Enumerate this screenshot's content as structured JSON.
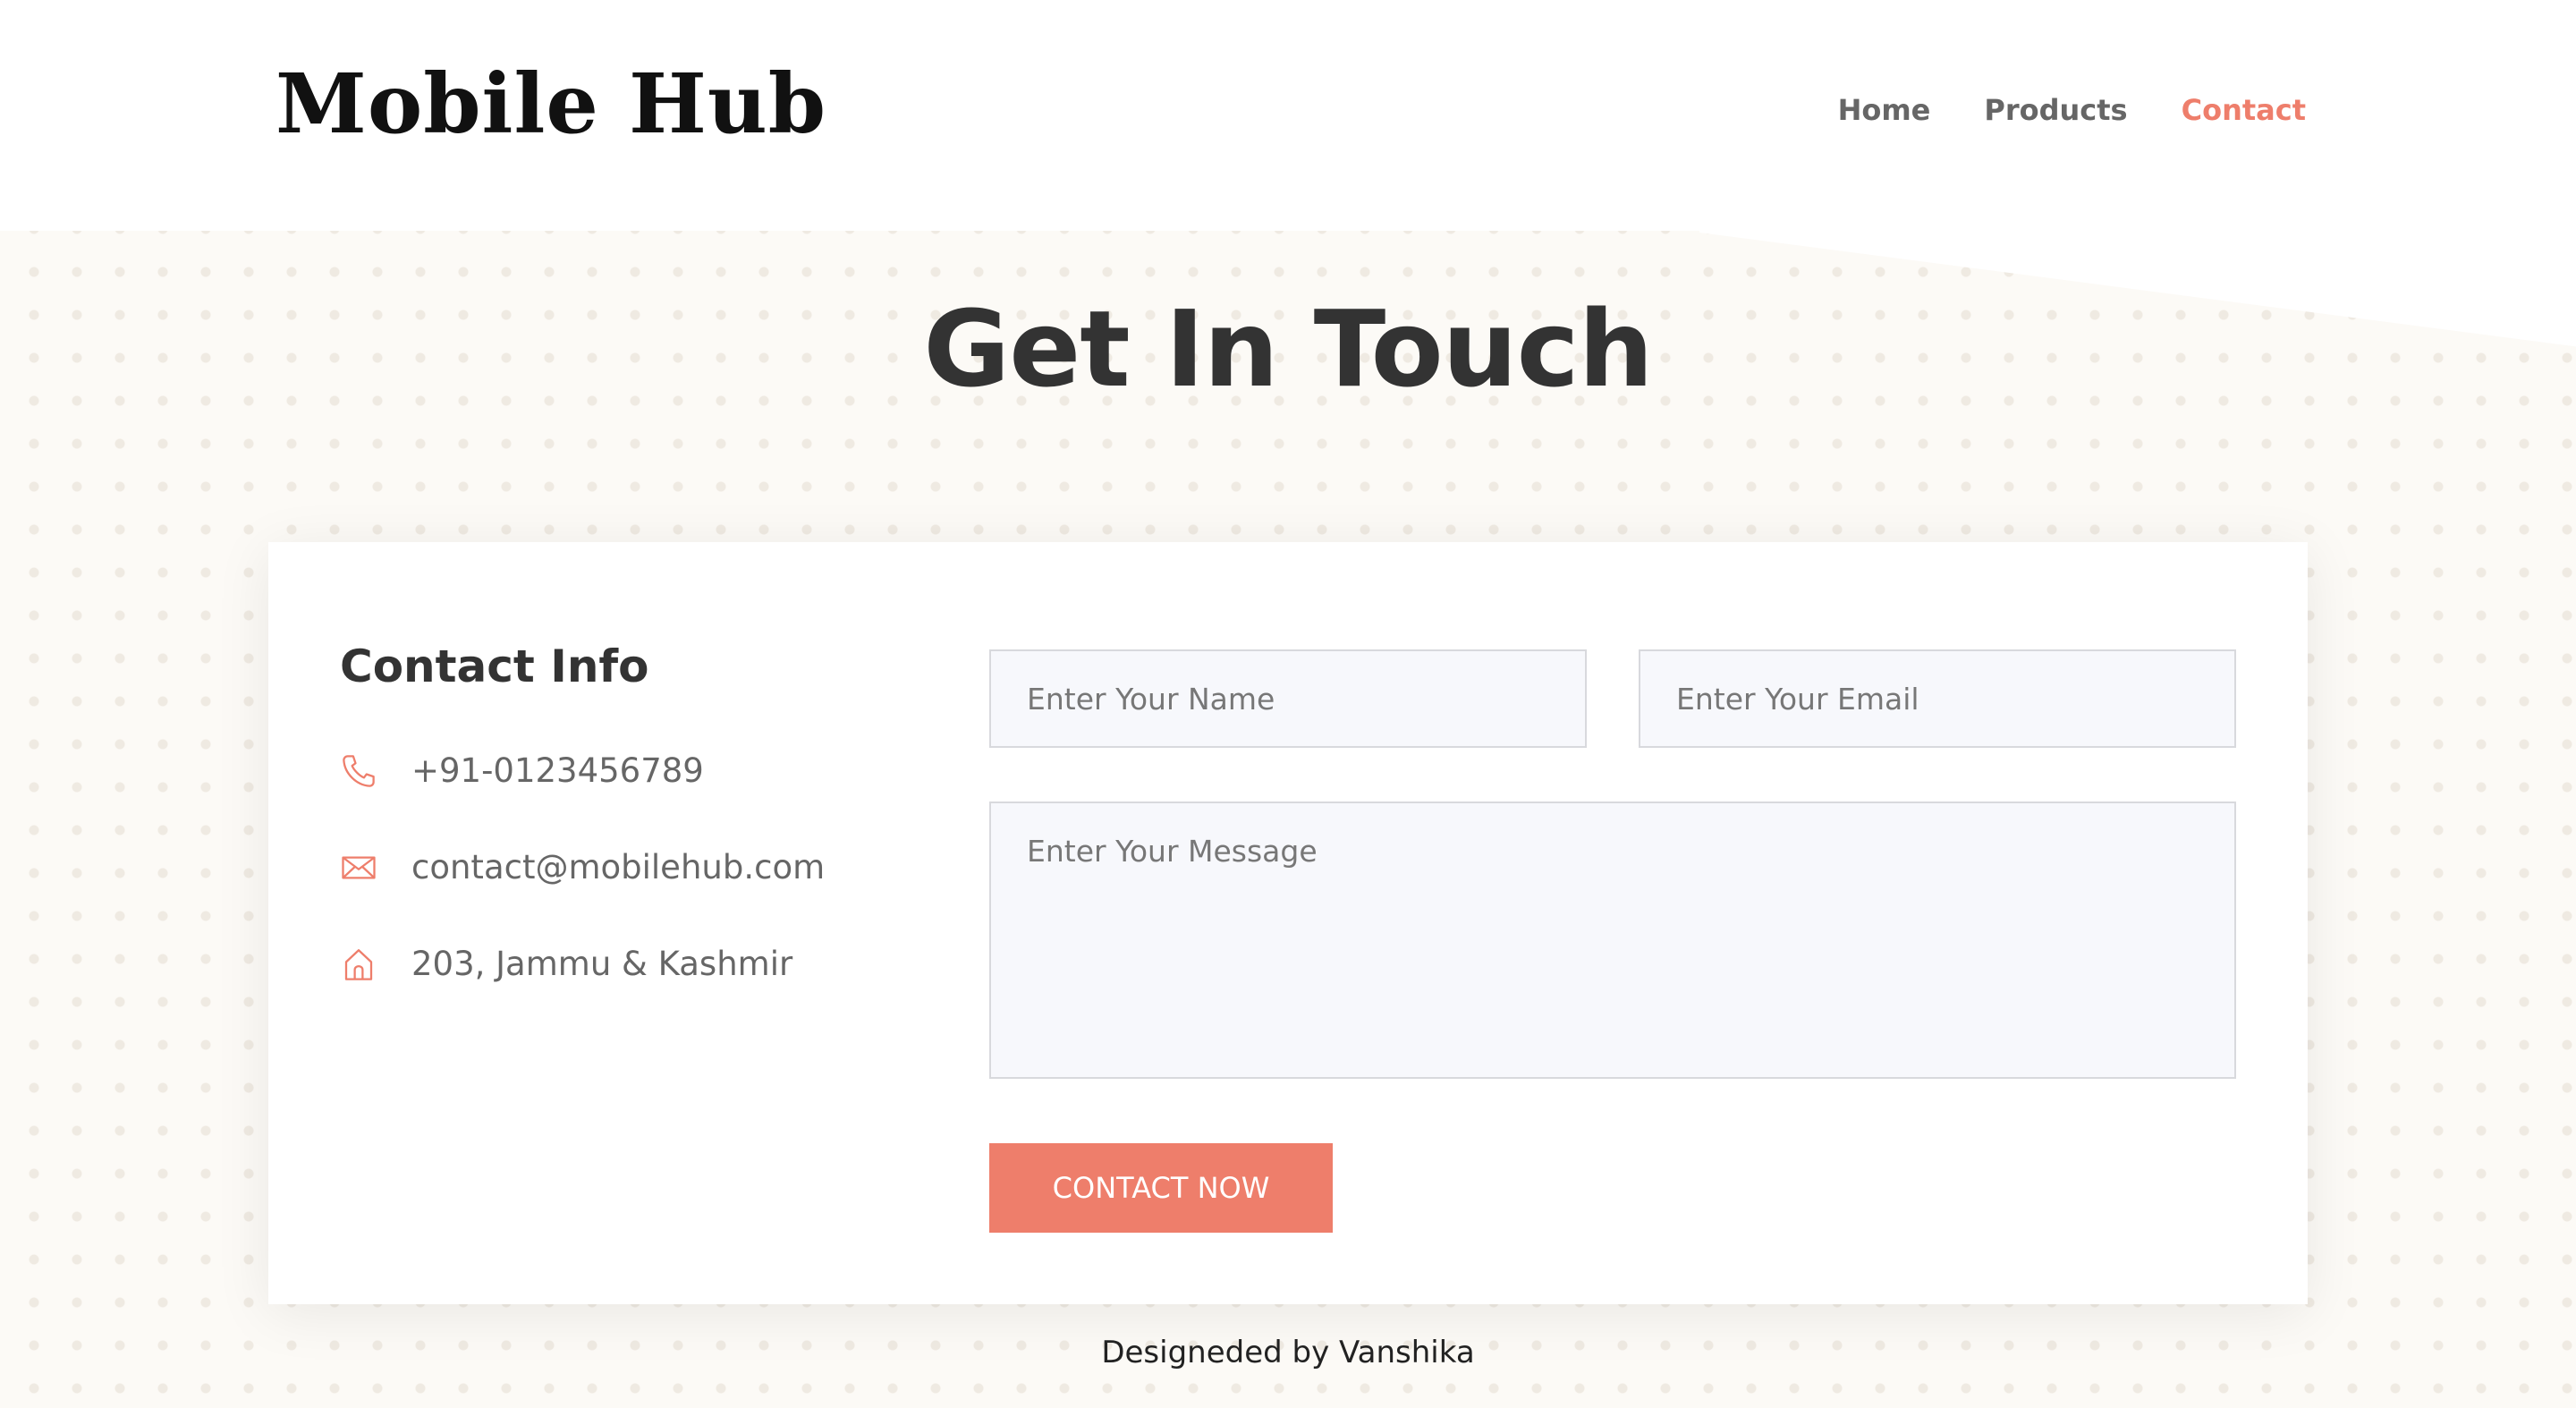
{
  "brand": {
    "name": "Mobile Hub"
  },
  "nav": {
    "items": [
      {
        "label": "Home"
      },
      {
        "label": "Products"
      },
      {
        "label": "Contact",
        "active": true
      }
    ]
  },
  "hero": {
    "title": "Get In Touch"
  },
  "contact_info": {
    "title": "Contact Info",
    "phone": {
      "icon": "phone-icon",
      "text": "+91-0123456789"
    },
    "email": {
      "icon": "envelope-icon",
      "text": "contact@mobilehub.com"
    },
    "address": {
      "icon": "home-icon",
      "text": "203, Jammu & Kashmir"
    }
  },
  "form": {
    "name_placeholder": "Enter Your Name",
    "email_placeholder": "Enter Your Email",
    "message_placeholder": "Enter Your Message",
    "submit_label": "CONTACT NOW"
  },
  "footer": {
    "text": "Designeded by Vanshika"
  },
  "colors": {
    "accent": "#ee7e6b",
    "text_dark": "#333333",
    "text_muted": "#666666",
    "background": "#fcfaf6",
    "input_bg": "#f7f8fc"
  }
}
